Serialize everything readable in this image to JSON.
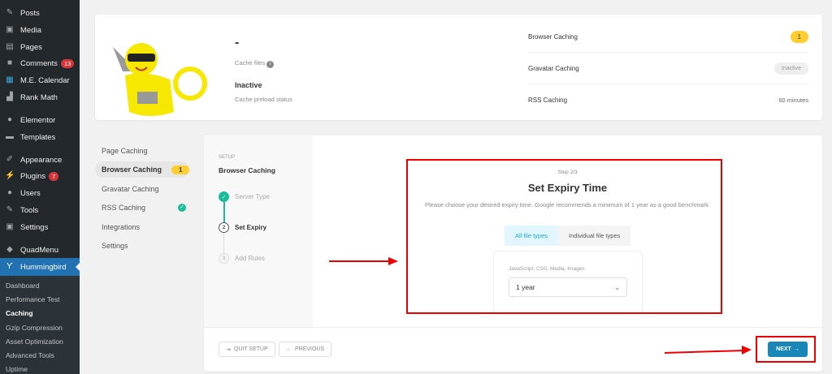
{
  "wp_menu": [
    {
      "label": "Posts",
      "icon": "pin-icon"
    },
    {
      "label": "Media",
      "icon": "media-icon"
    },
    {
      "label": "Pages",
      "icon": "pages-icon"
    },
    {
      "label": "Comments",
      "icon": "comment-icon",
      "badge": "13"
    },
    {
      "label": "M.E. Calendar",
      "icon": "calendar-icon"
    },
    {
      "label": "Rank Math",
      "icon": "chart-icon"
    },
    {
      "label": "Elementor",
      "icon": "elementor-icon"
    },
    {
      "label": "Templates",
      "icon": "folder-icon"
    },
    {
      "label": "Appearance",
      "icon": "brush-icon"
    },
    {
      "label": "Plugins",
      "icon": "plug-icon",
      "badge": "7"
    },
    {
      "label": "Users",
      "icon": "user-icon"
    },
    {
      "label": "Tools",
      "icon": "wrench-icon"
    },
    {
      "label": "Settings",
      "icon": "settings-icon"
    },
    {
      "label": "QuadMenu",
      "icon": "quadmenu-icon"
    },
    {
      "label": "Hummingbird",
      "icon": "hummingbird-icon"
    }
  ],
  "submenu": [
    "Dashboard",
    "Performance Test",
    "Caching",
    "Gzip Compression",
    "Asset Optimization",
    "Advanced Tools",
    "Uptime"
  ],
  "summary": {
    "cache_value": "-",
    "cache_label": "Cache files",
    "preload_value": "Inactive",
    "preload_label": "Cache preload status",
    "rows": [
      {
        "label": "Browser Caching",
        "value": "1"
      },
      {
        "label": "Gravatar Caching",
        "value": "Inactive"
      },
      {
        "label": "RSS Caching",
        "value": "60 minutes"
      }
    ]
  },
  "nav": [
    {
      "label": "Page Caching"
    },
    {
      "label": "Browser Caching",
      "badge": "1"
    },
    {
      "label": "Gravatar Caching"
    },
    {
      "label": "RSS Caching",
      "check": true
    },
    {
      "label": "Integrations"
    },
    {
      "label": "Settings"
    }
  ],
  "setup": {
    "eyebrow": "SETUP",
    "title": "Browser Caching",
    "steps": [
      {
        "num": "✓",
        "label": "Server Type"
      },
      {
        "num": "2",
        "label": "Set Expiry"
      },
      {
        "num": "3",
        "label": "Add Rules"
      }
    ]
  },
  "wizard": {
    "step": "Step 2/3",
    "title": "Set Expiry Time",
    "desc": "Please choose your desired expiry time. Google recommends a minimum of 1 year as a good benchmark.",
    "tabs": [
      "All file types",
      "Individual file types"
    ],
    "field_label": "JavaScript, CSS, Media, Images",
    "select_value": "1 year"
  },
  "footer": {
    "quit": "QUIT SETUP",
    "previous": "PREVIOUS",
    "next": "NEXT"
  },
  "colors": {
    "accent": "#1a86b8",
    "green": "#1abc9c",
    "yellow": "#fecf2f",
    "annotation": "#ee0000"
  }
}
